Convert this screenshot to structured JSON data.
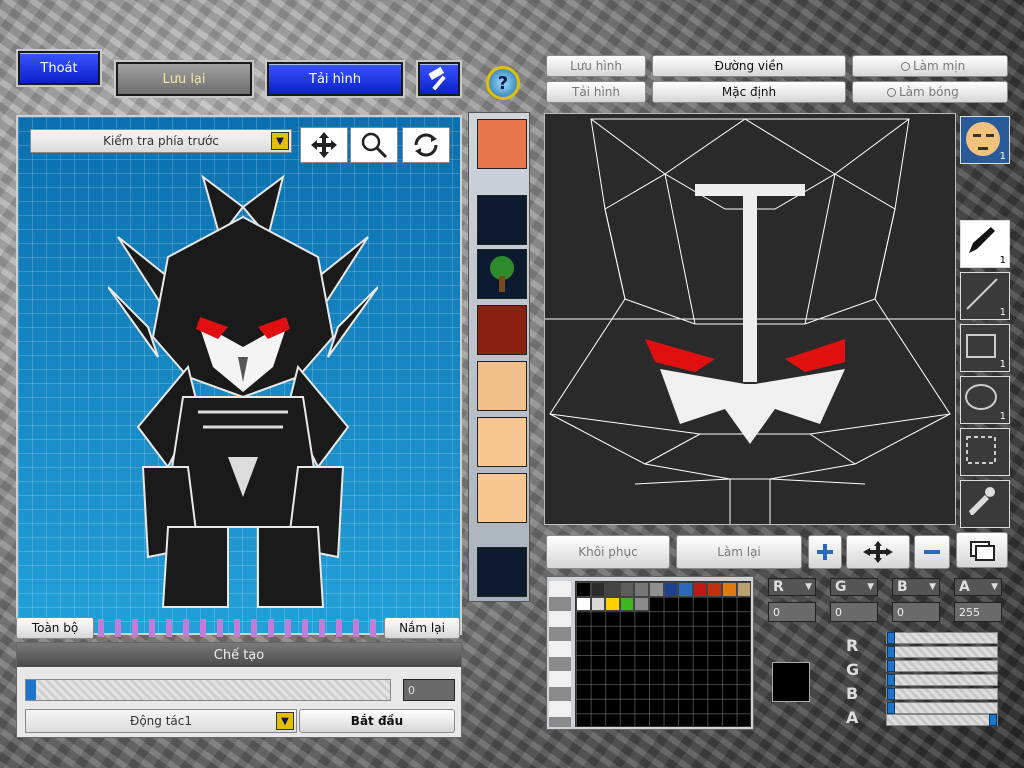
{
  "top_bar": {
    "exit_label": "Thoát",
    "save_label": "Lưu lại",
    "reload_label": "Tải hình"
  },
  "canvas_toolbar": {
    "save_image_label": "Lưu hình",
    "load_image_label": "Tải hình",
    "outline_label": "Đường viền",
    "default_label": "Mặc định",
    "smooth_label": "Làm mịn",
    "shade_label": "Làm bóng"
  },
  "preview": {
    "view_select": "Kiểm tra phía trước",
    "all_label": "Toàn bộ",
    "grab_label": "Nắm lại"
  },
  "create": {
    "title": "Chế tạo",
    "progress_value": "0",
    "progress_fraction": 0,
    "action_select": "Động tác1",
    "start_label": "Bắt đầu"
  },
  "canvas_actions": {
    "restore_label": "Khôi phục",
    "redo_label": "Làm lại"
  },
  "right_tools": {
    "face_count": "1",
    "pencil_count": "1",
    "line_count": "1",
    "rect_count": "1",
    "ellipse_count": "1"
  },
  "color": {
    "r_label": "R",
    "g_label": "G",
    "b_label": "B",
    "a_label": "A",
    "r_value": "0",
    "g_value": "0",
    "b_value": "0",
    "a_value": "255",
    "current": "#000000",
    "palette_row1": [
      "#000000",
      "#2b2b2b",
      "#444444",
      "#5d5d5d",
      "#777777",
      "#909090",
      "#1f3f8f",
      "#2a6ab8",
      "#c01818",
      "#c03010",
      "#e07a10",
      "#b8a070"
    ],
    "palette_row2": [
      "#ffffff",
      "#d8d8d8",
      "#ffd000",
      "#3cb81c",
      "#8a8a8a"
    ]
  }
}
